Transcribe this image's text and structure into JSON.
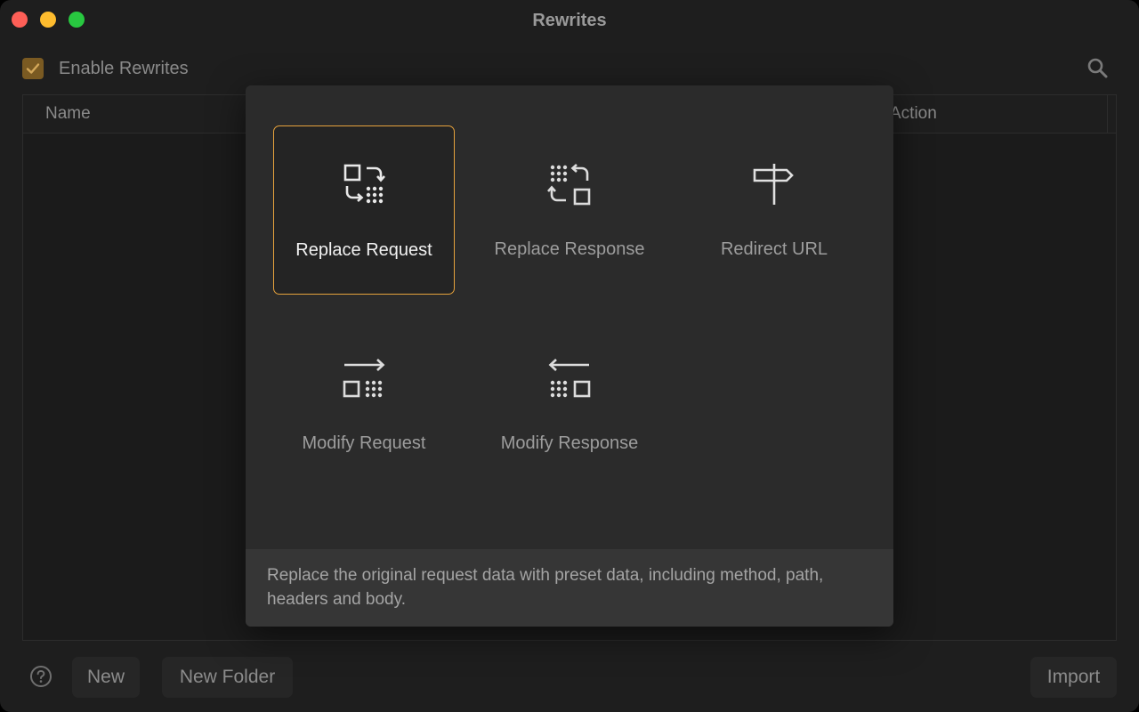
{
  "window": {
    "title": "Rewrites"
  },
  "toolbar": {
    "enable_label": "Enable Rewrites",
    "enabled": true
  },
  "table": {
    "columns": [
      "Name",
      "Action"
    ]
  },
  "footer": {
    "new_label": "New",
    "new_folder_label": "New Folder",
    "import_label": "Import"
  },
  "popover": {
    "options": [
      {
        "label": "Replace Request",
        "icon": "replace-request-icon",
        "selected": true
      },
      {
        "label": "Replace Response",
        "icon": "replace-response-icon",
        "selected": false
      },
      {
        "label": "Redirect URL",
        "icon": "signpost-icon",
        "selected": false
      },
      {
        "label": "Modify Request",
        "icon": "modify-request-icon",
        "selected": false
      },
      {
        "label": "Modify Response",
        "icon": "modify-response-icon",
        "selected": false
      }
    ],
    "description": "Replace the original request data with preset data, including method, path, headers and body."
  },
  "colors": {
    "accent": "#e6a23c",
    "checkbox": "#7a5a22",
    "background": "#1e1e1e",
    "popover": "#2b2b2b"
  }
}
